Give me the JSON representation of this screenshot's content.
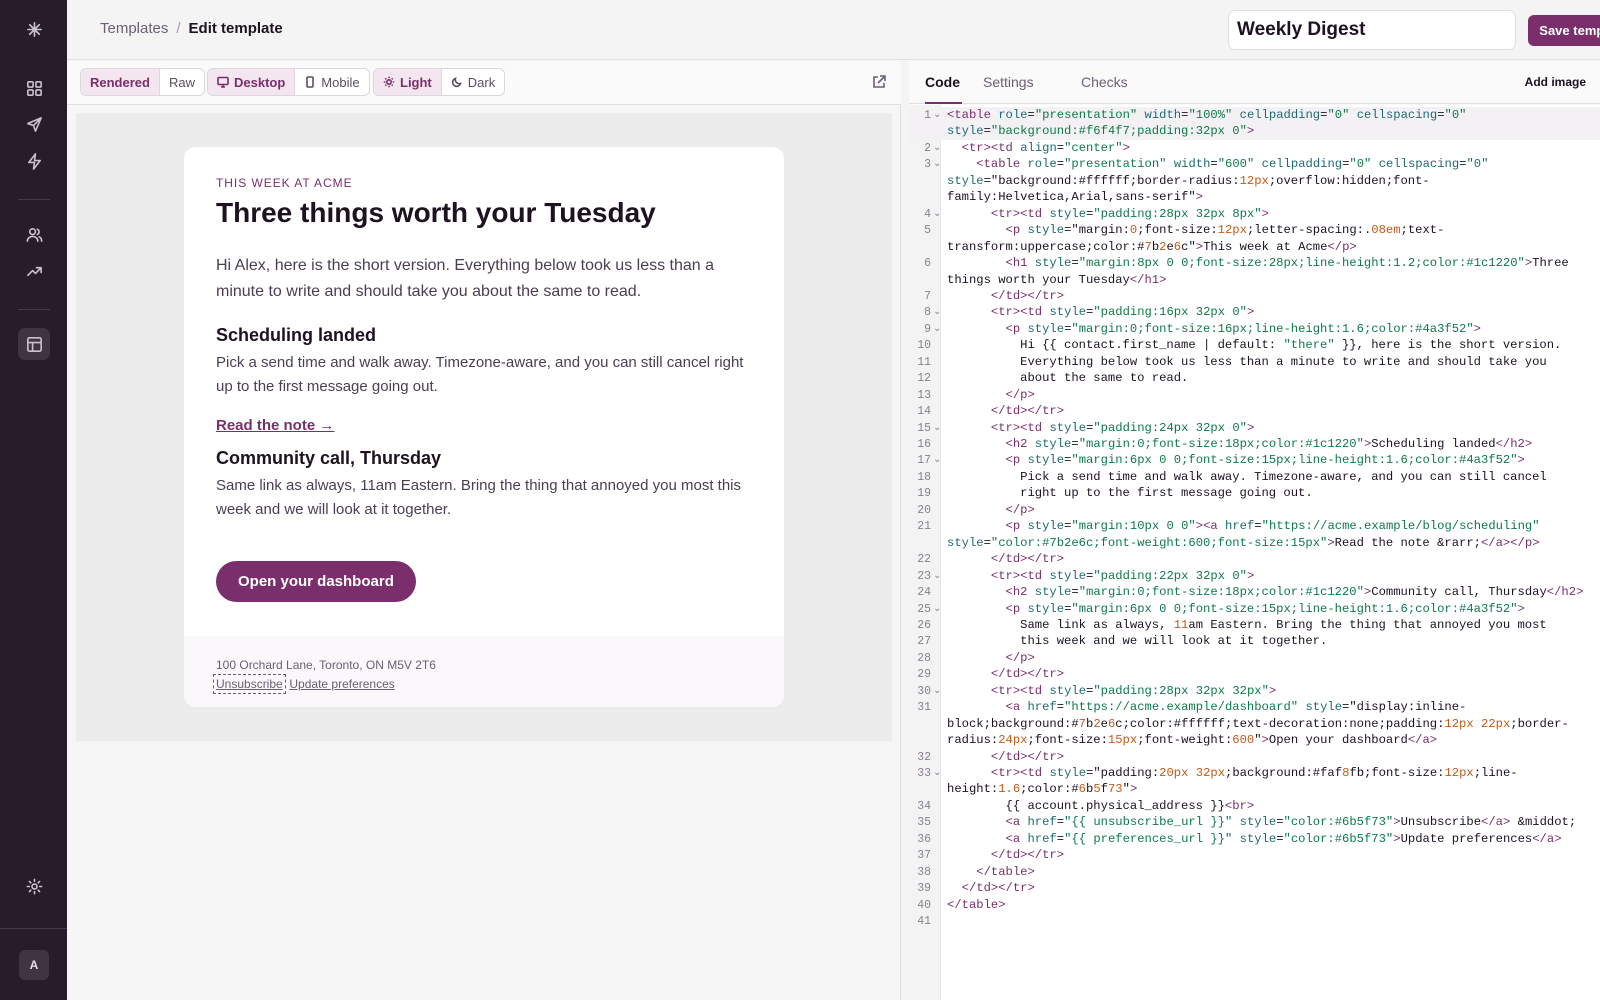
{
  "rail": {
    "logo": "sparkle-logo",
    "items": [
      "grid-icon",
      "send-icon",
      "bolt-icon",
      "users-icon",
      "trending-icon",
      "template-icon"
    ],
    "settings": "gear-icon",
    "avatar_initial": "A"
  },
  "header": {
    "breadcrumb_root": "Templates",
    "breadcrumb_sep": "/",
    "breadcrumb_current": "Edit template",
    "template_name": "Weekly Digest",
    "save_label": "Save template"
  },
  "preview": {
    "view_modes": [
      "Rendered",
      "Raw"
    ],
    "devices": [
      "Desktop",
      "Mobile"
    ],
    "themes": [
      "Light",
      "Dark"
    ],
    "email": {
      "eyebrow": "This week at Acme",
      "headline": "Three things worth your Tuesday",
      "intro": "Hi Alex, here is the short version. Everything below took us less than a minute to write and should take you about the same to read.",
      "section1_title": "Scheduling landed",
      "section1_body": "Pick a send time and walk away. Timezone-aware, and you can still cancel right up to the first message going out.",
      "section1_link": "Read the note →",
      "section2_title": "Community call, Thursday",
      "section2_body": "Same link as always, 11am Eastern. Bring the thing that annoyed you most this week and we will look at it together.",
      "cta": "Open your dashboard",
      "address": "100 Orchard Lane, Toronto, ON M5V 2T6",
      "unsubscribe": "Unsubscribe",
      "preferences": "Update preferences"
    }
  },
  "editor_panel": {
    "tabs": [
      "Code",
      "Settings",
      "Checks"
    ],
    "add_image": "Add image",
    "code_lines": [
      {
        "n": "1",
        "f": "⌄",
        "t": "<table role=\"presentation\" width=\"100%\" cellpadding=\"0\" cellspacing=\"0\""
      },
      {
        "n": "",
        "f": "",
        "t": "style=\"background:#f6f4f7;padding:32px 0\">"
      },
      {
        "n": "2",
        "f": "⌄",
        "t": "  <tr><td align=\"center\">"
      },
      {
        "n": "3",
        "f": "⌄",
        "t": "    <table role=\"presentation\" width=\"600\" cellpadding=\"0\" cellspacing=\"0\""
      },
      {
        "n": "",
        "f": "",
        "t": "style=\"background:#ffffff;border-radius:12px;overflow:hidden;font-"
      },
      {
        "n": "",
        "f": "",
        "t": "family:Helvetica,Arial,sans-serif\">"
      },
      {
        "n": "4",
        "f": "⌄",
        "t": "      <tr><td style=\"padding:28px 32px 8px\">"
      },
      {
        "n": "5",
        "f": "",
        "t": "        <p style=\"margin:0;font-size:12px;letter-spacing:.08em;text-"
      },
      {
        "n": "",
        "f": "",
        "t": "transform:uppercase;color:#7b2e6c\">This week at Acme</p>"
      },
      {
        "n": "6",
        "f": "",
        "t": "        <h1 style=\"margin:8px 0 0;font-size:28px;line-height:1.2;color:#1c1220\">Three"
      },
      {
        "n": "",
        "f": "",
        "t": "things worth your Tuesday</h1>"
      },
      {
        "n": "7",
        "f": "",
        "t": "      </td></tr>"
      },
      {
        "n": "8",
        "f": "⌄",
        "t": "      <tr><td style=\"padding:16px 32px 0\">"
      },
      {
        "n": "9",
        "f": "⌄",
        "t": "        <p style=\"margin:0;font-size:16px;line-height:1.6;color:#4a3f52\">"
      },
      {
        "n": "10",
        "f": "",
        "t": "          Hi {{ contact.first_name | default: \"there\" }}, here is the short version."
      },
      {
        "n": "11",
        "f": "",
        "t": "          Everything below took us less than a minute to write and should take you"
      },
      {
        "n": "12",
        "f": "",
        "t": "          about the same to read."
      },
      {
        "n": "13",
        "f": "",
        "t": "        </p>"
      },
      {
        "n": "14",
        "f": "",
        "t": "      </td></tr>"
      },
      {
        "n": "15",
        "f": "⌄",
        "t": "      <tr><td style=\"padding:24px 32px 0\">"
      },
      {
        "n": "16",
        "f": "",
        "t": "        <h2 style=\"margin:0;font-size:18px;color:#1c1220\">Scheduling landed</h2>"
      },
      {
        "n": "17",
        "f": "⌄",
        "t": "        <p style=\"margin:6px 0 0;font-size:15px;line-height:1.6;color:#4a3f52\">"
      },
      {
        "n": "18",
        "f": "",
        "t": "          Pick a send time and walk away. Timezone-aware, and you can still cancel"
      },
      {
        "n": "19",
        "f": "",
        "t": "          right up to the first message going out."
      },
      {
        "n": "20",
        "f": "",
        "t": "        </p>"
      },
      {
        "n": "21",
        "f": "",
        "t": "        <p style=\"margin:10px 0 0\"><a href=\"https://acme.example/blog/scheduling\""
      },
      {
        "n": "",
        "f": "",
        "t": "style=\"color:#7b2e6c;font-weight:600;font-size:15px\">Read the note &rarr;</a></p>"
      },
      {
        "n": "22",
        "f": "",
        "t": "      </td></tr>"
      },
      {
        "n": "23",
        "f": "⌄",
        "t": "      <tr><td style=\"padding:22px 32px 0\">"
      },
      {
        "n": "24",
        "f": "",
        "t": "        <h2 style=\"margin:0;font-size:18px;color:#1c1220\">Community call, Thursday</h2>"
      },
      {
        "n": "25",
        "f": "⌄",
        "t": "        <p style=\"margin:6px 0 0;font-size:15px;line-height:1.6;color:#4a3f52\">"
      },
      {
        "n": "26",
        "f": "",
        "t": "          Same link as always, 11am Eastern. Bring the thing that annoyed you most"
      },
      {
        "n": "27",
        "f": "",
        "t": "          this week and we will look at it together."
      },
      {
        "n": "28",
        "f": "",
        "t": "        </p>"
      },
      {
        "n": "29",
        "f": "",
        "t": "      </td></tr>"
      },
      {
        "n": "30",
        "f": "⌄",
        "t": "      <tr><td style=\"padding:28px 32px 32px\">"
      },
      {
        "n": "31",
        "f": "",
        "t": "        <a href=\"https://acme.example/dashboard\" style=\"display:inline-"
      },
      {
        "n": "",
        "f": "",
        "t": "block;background:#7b2e6c;color:#ffffff;text-decoration:none;padding:12px 22px;border-"
      },
      {
        "n": "",
        "f": "",
        "t": "radius:24px;font-size:15px;font-weight:600\">Open your dashboard</a>"
      },
      {
        "n": "32",
        "f": "",
        "t": "      </td></tr>"
      },
      {
        "n": "33",
        "f": "⌄",
        "t": "      <tr><td style=\"padding:20px 32px;background:#faf8fb;font-size:12px;line-"
      },
      {
        "n": "",
        "f": "",
        "t": "height:1.6;color:#6b5f73\">"
      },
      {
        "n": "34",
        "f": "",
        "t": "        {{ account.physical_address }}<br>"
      },
      {
        "n": "35",
        "f": "",
        "t": "        <a href=\"{{ unsubscribe_url }}\" style=\"color:#6b5f73\">Unsubscribe</a> &middot;"
      },
      {
        "n": "36",
        "f": "",
        "t": "        <a href=\"{{ preferences_url }}\" style=\"color:#6b5f73\">Update preferences</a>"
      },
      {
        "n": "37",
        "f": "",
        "t": "      </td></tr>"
      },
      {
        "n": "38",
        "f": "",
        "t": "    </table>"
      },
      {
        "n": "39",
        "f": "",
        "t": "  </td></tr>"
      },
      {
        "n": "40",
        "f": "",
        "t": "</table>"
      },
      {
        "n": "41",
        "f": "",
        "t": ""
      }
    ]
  },
  "colors": {
    "brand": "#7b2e6c",
    "rail": "#271d29",
    "text": "#1c1220",
    "muted": "#6b5f73"
  }
}
